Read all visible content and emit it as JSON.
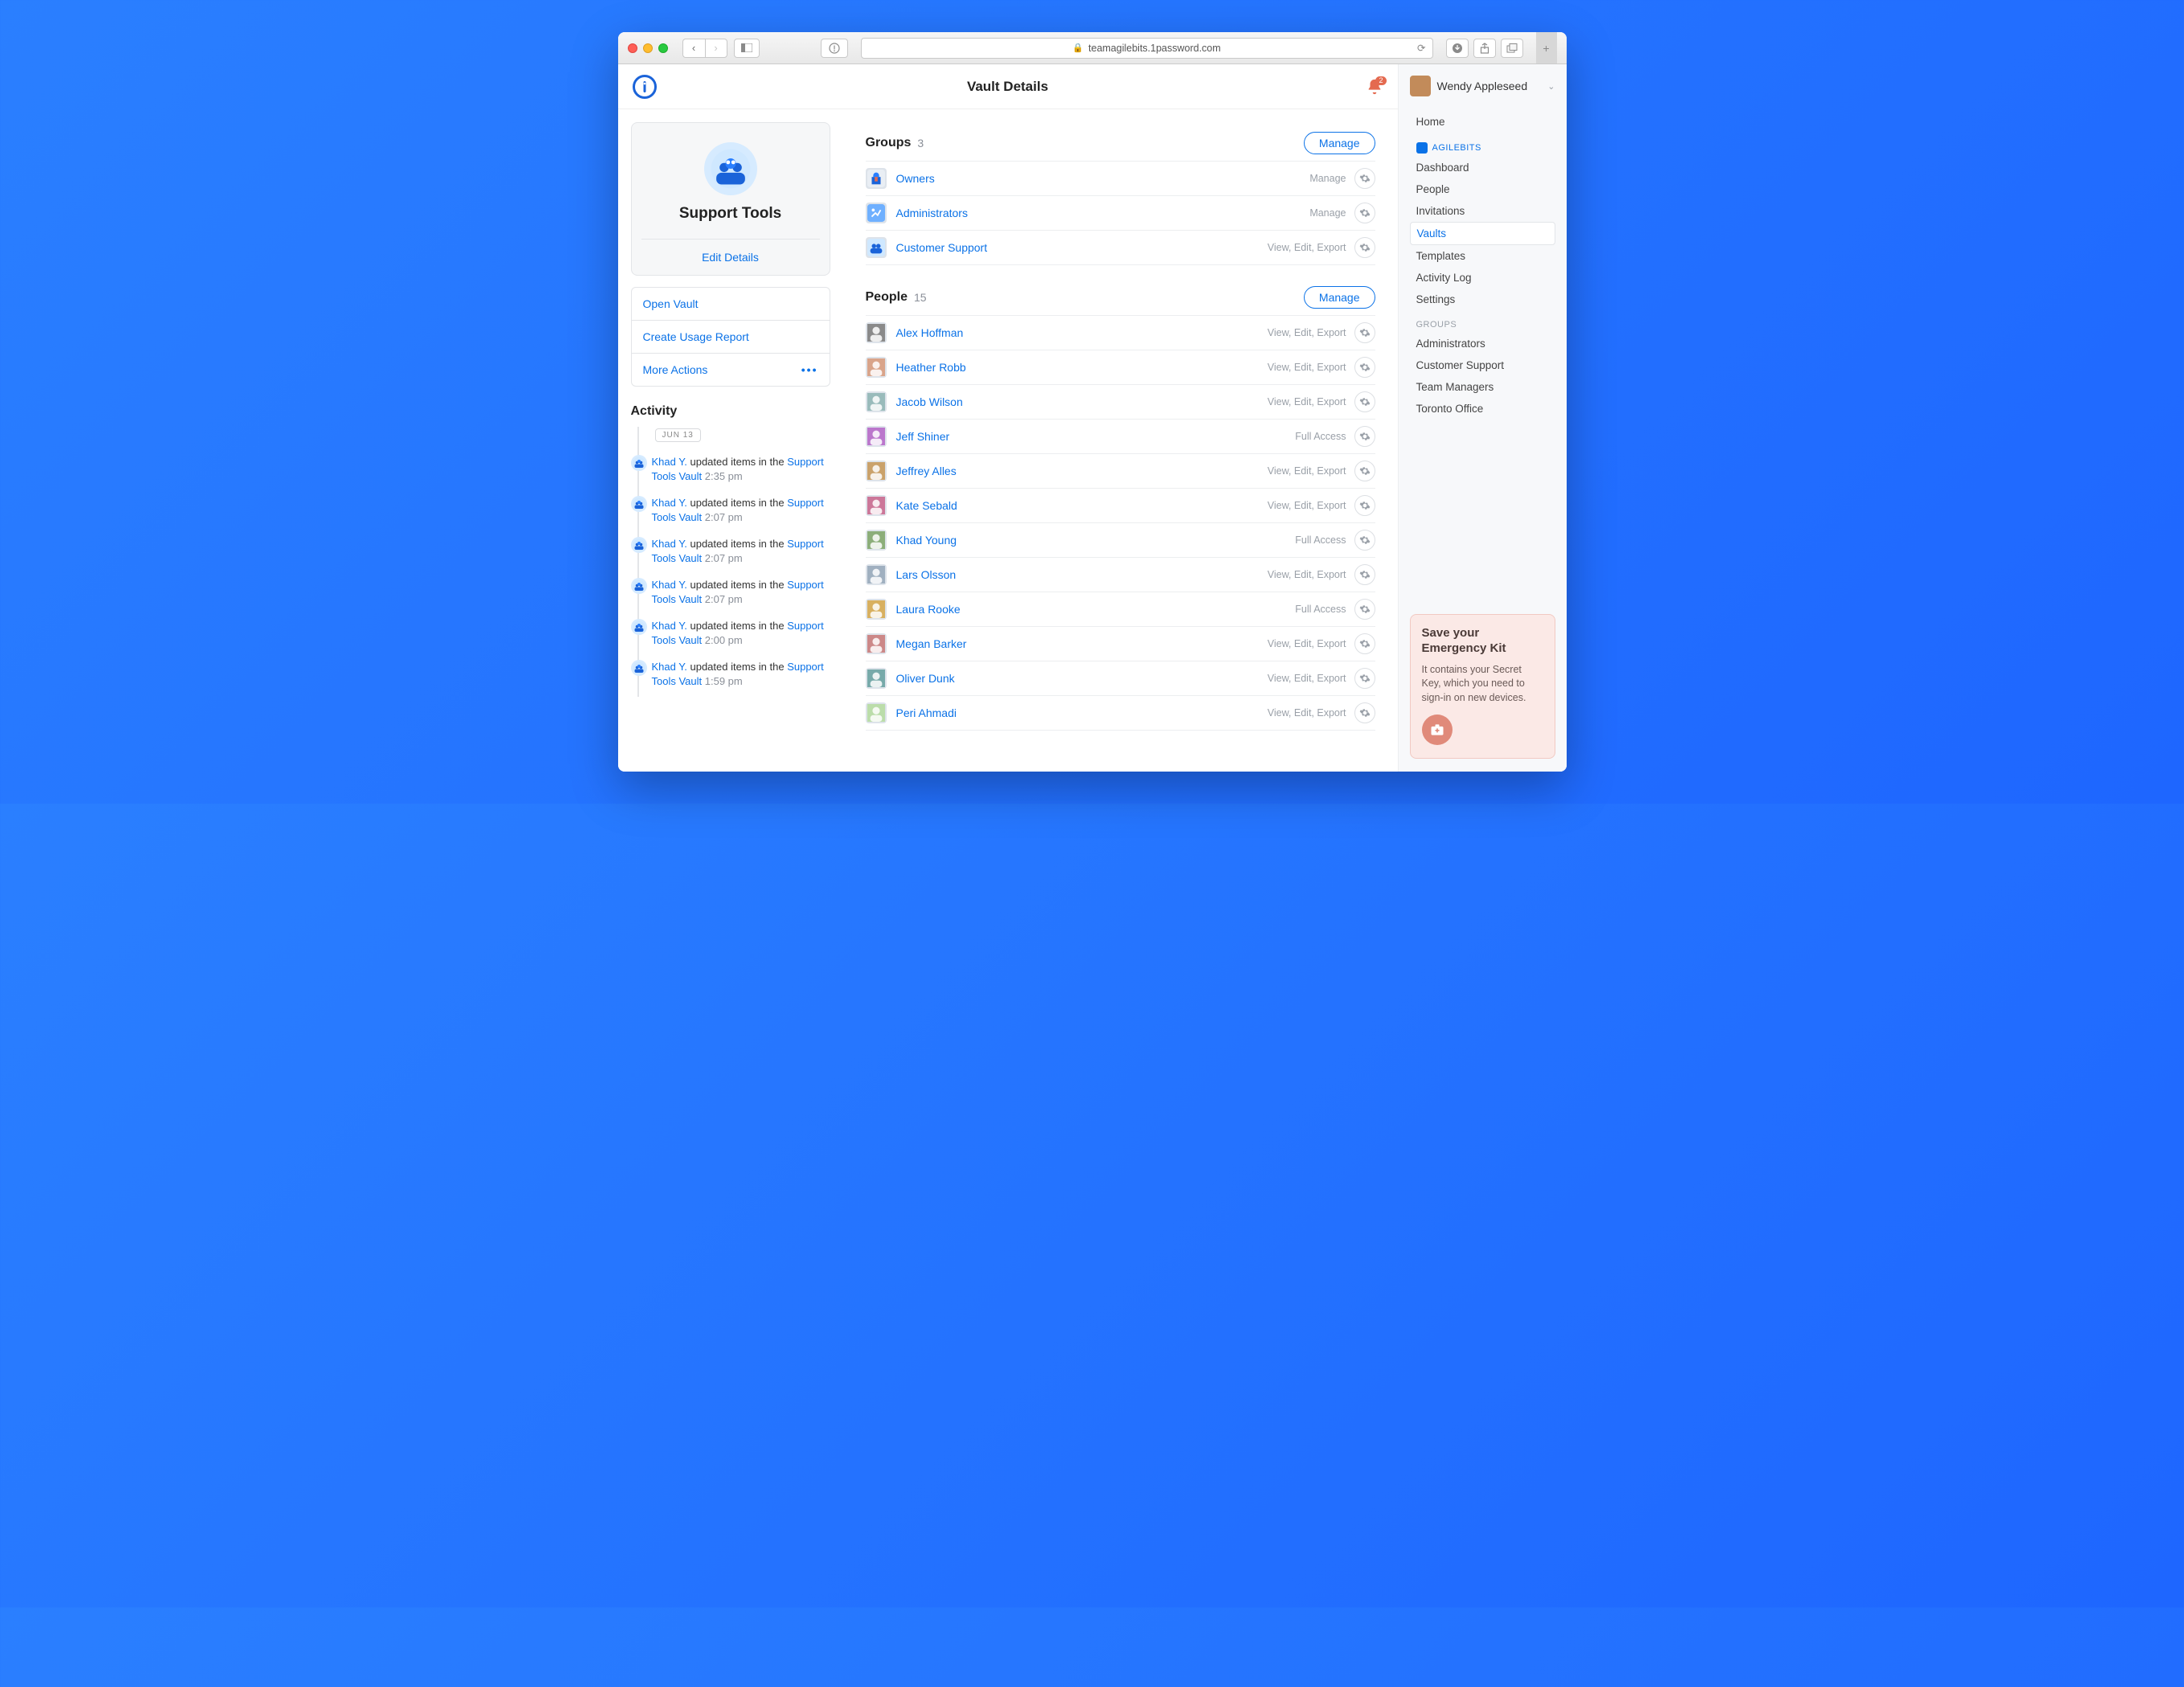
{
  "browser": {
    "url": "teamagilebits.1password.com"
  },
  "header": {
    "title": "Vault Details",
    "notif_count": "2"
  },
  "vault": {
    "name": "Support Tools",
    "edit_label": "Edit Details"
  },
  "vault_actions": {
    "open": "Open Vault",
    "usage": "Create Usage Report",
    "more": "More Actions"
  },
  "activity": {
    "title": "Activity",
    "date_label": "JUN 13",
    "items": [
      {
        "user": "Khad Y.",
        "text": "updated items in the",
        "link": "Support Tools Vault",
        "time": "2:35 pm"
      },
      {
        "user": "Khad Y.",
        "text": "updated items in the",
        "link": "Support Tools Vault",
        "time": "2:07 pm"
      },
      {
        "user": "Khad Y.",
        "text": "updated items in the",
        "link": "Support Tools Vault",
        "time": "2:07 pm"
      },
      {
        "user": "Khad Y.",
        "text": "updated items in the",
        "link": "Support Tools Vault",
        "time": "2:07 pm"
      },
      {
        "user": "Khad Y.",
        "text": "updated items in the",
        "link": "Support Tools Vault",
        "time": "2:00 pm"
      },
      {
        "user": "Khad Y.",
        "text": "updated items in the",
        "link": "Support Tools Vault",
        "time": "1:59 pm"
      }
    ]
  },
  "groups": {
    "title": "Groups",
    "count": "3",
    "manage": "Manage",
    "items": [
      {
        "name": "Owners",
        "perm": "Manage"
      },
      {
        "name": "Administrators",
        "perm": "Manage"
      },
      {
        "name": "Customer Support",
        "perm": "View, Edit, Export"
      }
    ]
  },
  "people": {
    "title": "People",
    "count": "15",
    "manage": "Manage",
    "items": [
      {
        "name": "Alex Hoffman",
        "perm": "View, Edit, Export"
      },
      {
        "name": "Heather Robb",
        "perm": "View, Edit, Export"
      },
      {
        "name": "Jacob Wilson",
        "perm": "View, Edit, Export"
      },
      {
        "name": "Jeff Shiner",
        "perm": "Full Access"
      },
      {
        "name": "Jeffrey Alles",
        "perm": "View, Edit, Export"
      },
      {
        "name": "Kate Sebald",
        "perm": "View, Edit, Export"
      },
      {
        "name": "Khad Young",
        "perm": "Full Access"
      },
      {
        "name": "Lars Olsson",
        "perm": "View, Edit, Export"
      },
      {
        "name": "Laura Rooke",
        "perm": "Full Access"
      },
      {
        "name": "Megan Barker",
        "perm": "View, Edit, Export"
      },
      {
        "name": "Oliver Dunk",
        "perm": "View, Edit, Export"
      },
      {
        "name": "Peri Ahmadi",
        "perm": "View, Edit, Export"
      }
    ]
  },
  "sidebar": {
    "user": "Wendy Appleseed",
    "home": "Home",
    "brand": "AGILEBITS",
    "items": [
      {
        "label": "Dashboard"
      },
      {
        "label": "People"
      },
      {
        "label": "Invitations"
      },
      {
        "label": "Vaults",
        "active": true
      },
      {
        "label": "Templates"
      },
      {
        "label": "Activity Log"
      },
      {
        "label": "Settings"
      }
    ],
    "groups_label": "GROUPS",
    "groups": [
      {
        "label": "Administrators"
      },
      {
        "label": "Customer Support"
      },
      {
        "label": "Team Managers"
      },
      {
        "label": "Toronto Office"
      }
    ]
  },
  "ek": {
    "title": "Save your Emergency Kit",
    "body": "It contains your Secret Key, which you need to sign-in on new devices."
  }
}
